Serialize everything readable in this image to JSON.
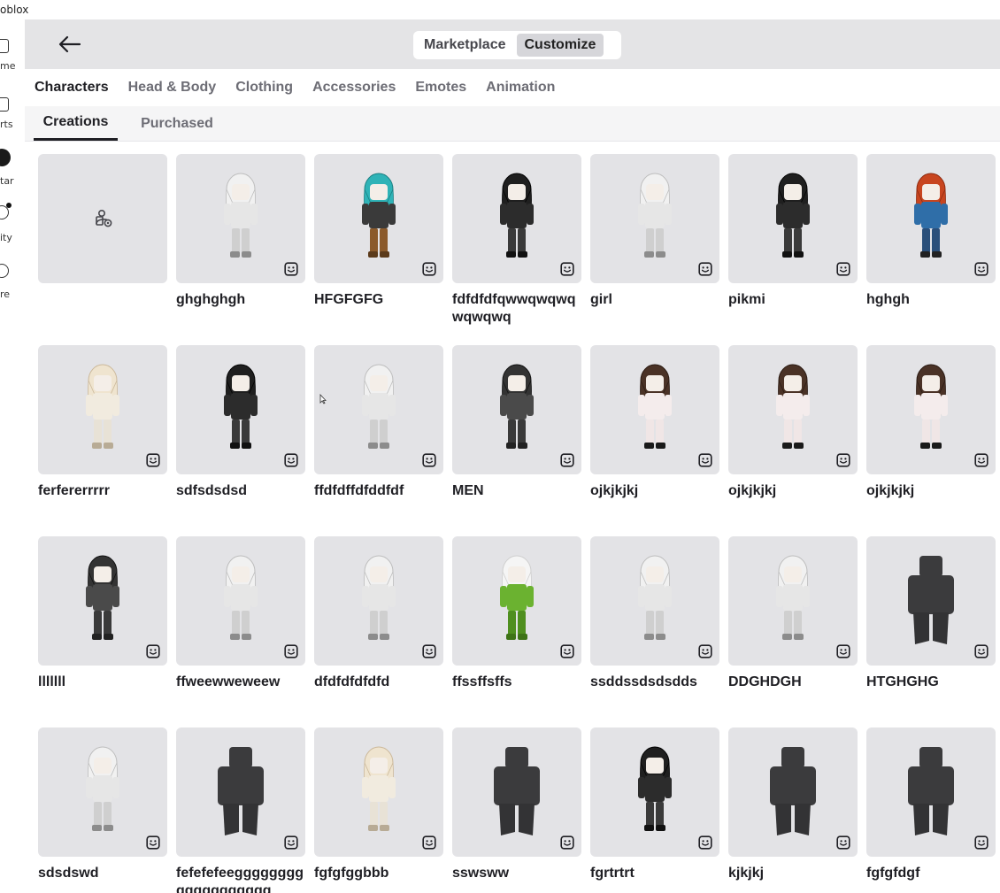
{
  "app": {
    "title": "oblox"
  },
  "sidebar": {
    "items": [
      {
        "label": "me",
        "icon": "home-icon"
      },
      {
        "label": "rts",
        "icon": "charts-icon"
      },
      {
        "label": "tar",
        "icon": "avatar-icon"
      },
      {
        "label": "ity",
        "icon": "community-icon"
      },
      {
        "label": "re",
        "icon": "more-icon"
      }
    ]
  },
  "header": {
    "back_icon": "back-arrow-icon",
    "segments": [
      {
        "label": "Marketplace",
        "active": false
      },
      {
        "label": "Customize",
        "active": true
      }
    ]
  },
  "category_tabs": [
    {
      "label": "Characters",
      "active": true
    },
    {
      "label": "Head & Body",
      "active": false
    },
    {
      "label": "Clothing",
      "active": false
    },
    {
      "label": "Accessories",
      "active": false
    },
    {
      "label": "Emotes",
      "active": false
    },
    {
      "label": "Animation",
      "active": false
    }
  ],
  "sub_tabs": [
    {
      "label": "Creations",
      "active": true
    },
    {
      "label": "Purchased",
      "active": false
    }
  ],
  "create_card": {
    "icon": "create-character-icon"
  },
  "characters": [
    {
      "name": "ghghghgh",
      "style": "white"
    },
    {
      "name": "HFGFGFG",
      "style": "teal"
    },
    {
      "name": "fdfdfdfqwwqwqwqwqwqwq",
      "style": "black"
    },
    {
      "name": "girl",
      "style": "white"
    },
    {
      "name": "pikmi",
      "style": "black"
    },
    {
      "name": "hghgh",
      "style": "red"
    },
    {
      "name": "ferfererrrrr",
      "style": "cream"
    },
    {
      "name": "sdfsdsdsd",
      "style": "black"
    },
    {
      "name": "ffdfdffdfddfdf",
      "style": "white"
    },
    {
      "name": "MEN",
      "style": "dark"
    },
    {
      "name": "ojkjkjkj",
      "style": "brown"
    },
    {
      "name": "ojkjkjkj",
      "style": "brown"
    },
    {
      "name": "ojkjkjkj",
      "style": "brown"
    },
    {
      "name": "lllllll",
      "style": "dark"
    },
    {
      "name": "ffweewweweew",
      "style": "white"
    },
    {
      "name": "dfdfdfdfdfd",
      "style": "white"
    },
    {
      "name": "ffssffsffs",
      "style": "green"
    },
    {
      "name": "ssddssdsdsdds",
      "style": "white"
    },
    {
      "name": "DDGHDGH",
      "style": "white"
    },
    {
      "name": "HTGHGHG",
      "style": "blank"
    },
    {
      "name": "sdsdswd",
      "style": "white"
    },
    {
      "name": "fefefefeeggggggggggggggggggg",
      "style": "blank"
    },
    {
      "name": "fgfgfggbbb",
      "style": "cream"
    },
    {
      "name": "sswsww",
      "style": "blank"
    },
    {
      "name": "fgrtrtrt",
      "style": "black"
    },
    {
      "name": "kjkjkj",
      "style": "blank"
    },
    {
      "name": "fgfgfdgf",
      "style": "blank"
    }
  ],
  "colors": {
    "topbar_bg": "#e4e4e6",
    "thumb_bg": "#e3e3e6",
    "active_segment": "#d6d6da",
    "text_primary": "#1f1f24",
    "text_muted": "#6d6d75"
  }
}
